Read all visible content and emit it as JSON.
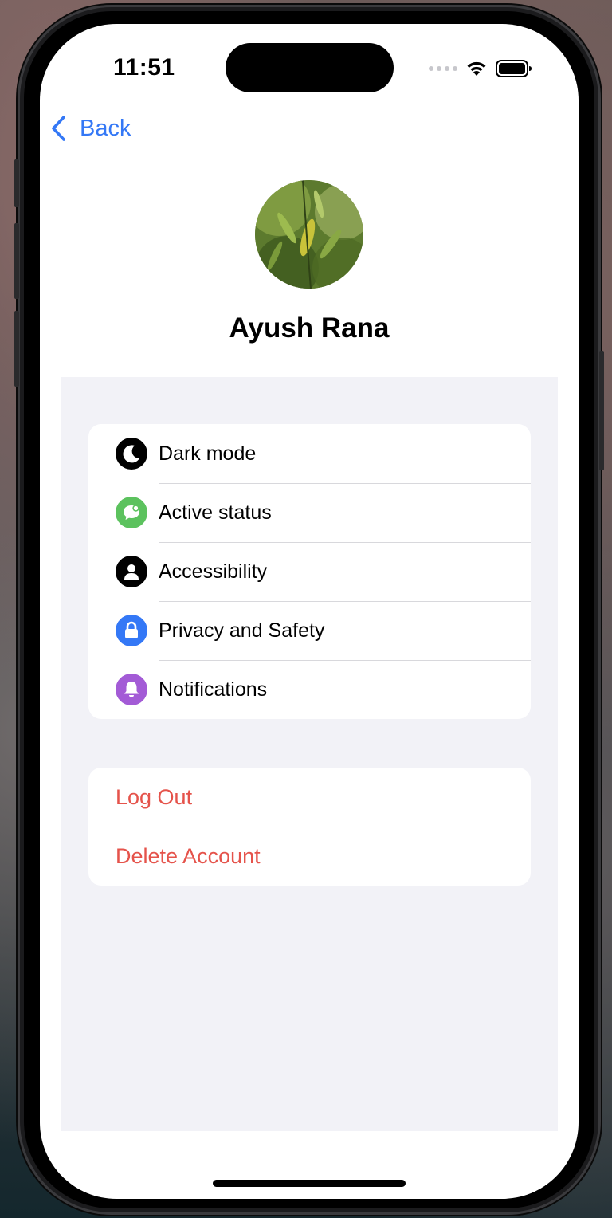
{
  "status_bar": {
    "time": "11:51"
  },
  "nav": {
    "back_label": "Back"
  },
  "profile": {
    "name": "Ayush Rana"
  },
  "settings": {
    "items": [
      {
        "label": "Dark mode",
        "icon": "moon-icon",
        "color": "#000000"
      },
      {
        "label": "Active status",
        "icon": "chat-bubble-icon",
        "color": "#5cc25e"
      },
      {
        "label": "Accessibility",
        "icon": "person-icon",
        "color": "#000000"
      },
      {
        "label": "Privacy and Safety",
        "icon": "lock-icon",
        "color": "#3478f6"
      },
      {
        "label": "Notifications",
        "icon": "bell-icon",
        "color": "#a35bd6"
      }
    ]
  },
  "account_actions": {
    "logout_label": "Log Out",
    "delete_label": "Delete Account",
    "color": "#e5534b"
  },
  "theme": {
    "accent": "#3478f6",
    "background": "#f2f2f7"
  }
}
